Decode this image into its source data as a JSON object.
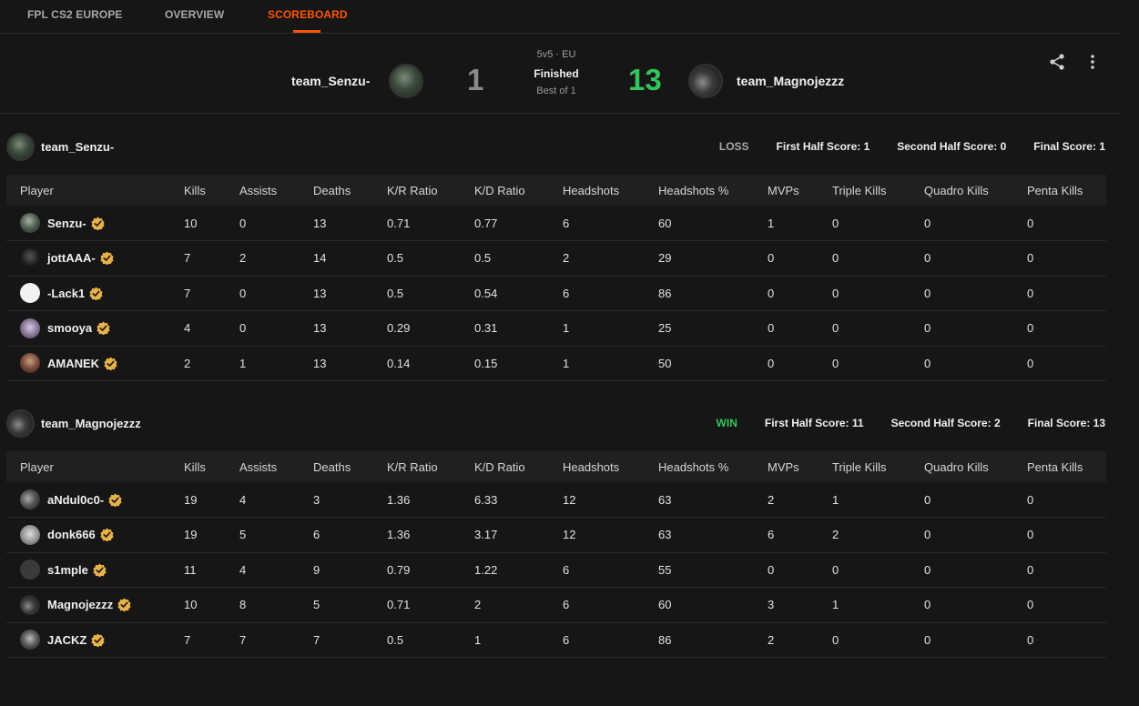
{
  "nav": {
    "tabs": [
      {
        "label": "FPL CS2 EUROPE",
        "active": false
      },
      {
        "label": "OVERVIEW",
        "active": false
      },
      {
        "label": "SCOREBOARD",
        "active": true
      }
    ],
    "accent_color": "#ff5500"
  },
  "match": {
    "format": "5v5 · EU",
    "status": "Finished",
    "best_of": "Best of 1",
    "team_left": {
      "name": "team_Senzu-",
      "score": "1"
    },
    "team_right": {
      "name": "team_Magnojezzz",
      "score": "13"
    },
    "win_color": "#32c55a",
    "actions": [
      "share-icon",
      "more-vertical-icon"
    ]
  },
  "columns": [
    "Player",
    "Kills",
    "Assists",
    "Deaths",
    "K/R Ratio",
    "K/D Ratio",
    "Headshots",
    "Headshots %",
    "MVPs",
    "Triple Kills",
    "Quadro Kills",
    "Penta Kills"
  ],
  "teams": [
    {
      "name": "team_Senzu-",
      "result": "LOSS",
      "first_half": "First Half Score: 1",
      "second_half": "Second Half Score: 0",
      "final": "Final Score: 1",
      "players": [
        {
          "name": "Senzu-",
          "stats": [
            "10",
            "0",
            "13",
            "0.71",
            "0.77",
            "6",
            "60",
            "1",
            "0",
            "0",
            "0"
          ]
        },
        {
          "name": "jottAAA-",
          "stats": [
            "7",
            "2",
            "14",
            "0.5",
            "0.5",
            "2",
            "29",
            "0",
            "0",
            "0",
            "0"
          ]
        },
        {
          "name": "-Lack1",
          "stats": [
            "7",
            "0",
            "13",
            "0.5",
            "0.54",
            "6",
            "86",
            "0",
            "0",
            "0",
            "0"
          ]
        },
        {
          "name": "smooya",
          "stats": [
            "4",
            "0",
            "13",
            "0.29",
            "0.31",
            "1",
            "25",
            "0",
            "0",
            "0",
            "0"
          ]
        },
        {
          "name": "AMANEK",
          "stats": [
            "2",
            "1",
            "13",
            "0.14",
            "0.15",
            "1",
            "50",
            "0",
            "0",
            "0",
            "0"
          ]
        }
      ]
    },
    {
      "name": "team_Magnojezzz",
      "result": "WIN",
      "first_half": "First Half Score: 11",
      "second_half": "Second Half Score: 2",
      "final": "Final Score: 13",
      "players": [
        {
          "name": "aNdul0c0-",
          "stats": [
            "19",
            "4",
            "3",
            "1.36",
            "6.33",
            "12",
            "63",
            "2",
            "1",
            "0",
            "0"
          ]
        },
        {
          "name": "donk666",
          "stats": [
            "19",
            "5",
            "6",
            "1.36",
            "3.17",
            "12",
            "63",
            "6",
            "2",
            "0",
            "0"
          ]
        },
        {
          "name": "s1mple",
          "stats": [
            "11",
            "4",
            "9",
            "0.79",
            "1.22",
            "6",
            "55",
            "0",
            "0",
            "0",
            "0"
          ]
        },
        {
          "name": "Magnojezzz",
          "stats": [
            "10",
            "8",
            "5",
            "0.71",
            "2",
            "6",
            "60",
            "3",
            "1",
            "0",
            "0"
          ]
        },
        {
          "name": "JACKZ",
          "stats": [
            "7",
            "7",
            "7",
            "0.5",
            "1",
            "6",
            "86",
            "2",
            "0",
            "0",
            "0"
          ]
        }
      ]
    }
  ]
}
